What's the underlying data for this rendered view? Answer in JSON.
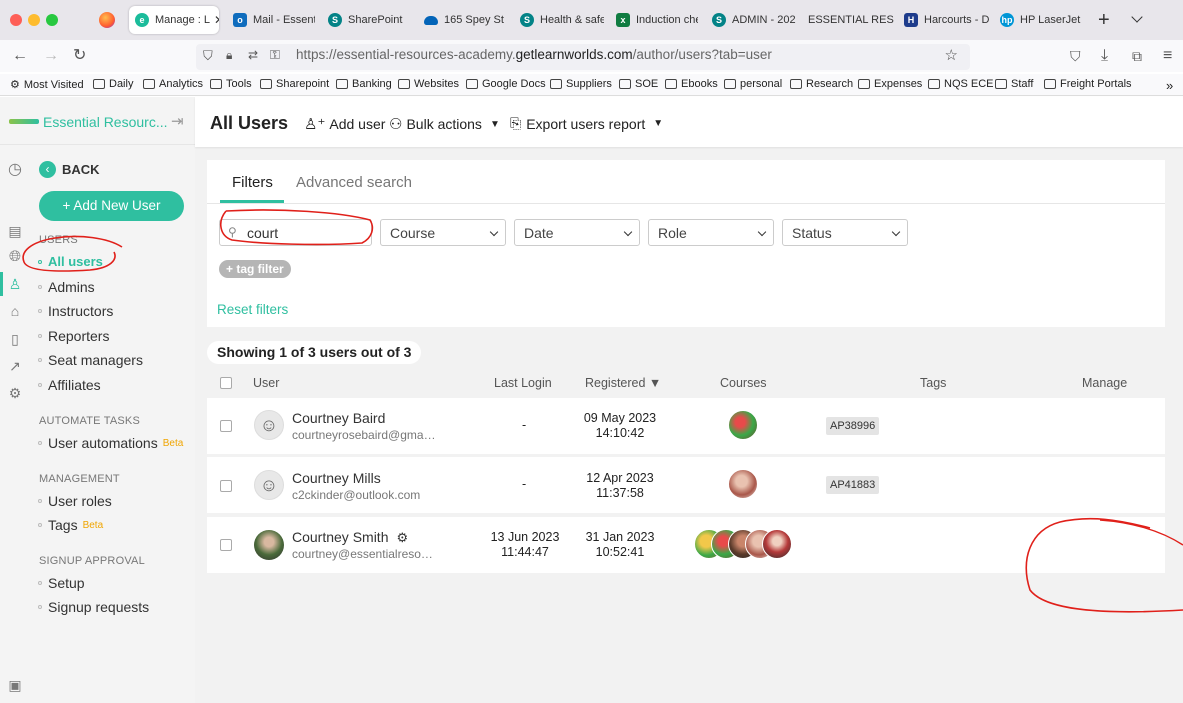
{
  "browser": {
    "tabs": [
      {
        "label": "Manage : L",
        "color": "#1bbc9b",
        "icon": "learnworlds-icon"
      },
      {
        "label": "Mail - Essenti",
        "color": "#0f6cbd",
        "icon": "outlook-icon"
      },
      {
        "label": "SharePoint",
        "color": "#038387",
        "icon": "sharepoint-icon"
      },
      {
        "label": "165 Spey St",
        "color": "#0364b8",
        "icon": "onedrive-icon"
      },
      {
        "label": "Health & safe",
        "color": "#038387",
        "icon": "sharepoint-icon"
      },
      {
        "label": "Induction che",
        "color": "#107c41",
        "icon": "excel-icon"
      },
      {
        "label": "ADMIN - 202",
        "color": "#038387",
        "icon": "sharepoint-icon"
      },
      {
        "label": "ESSENTIAL RESO",
        "color": "",
        "icon": "none"
      },
      {
        "label": "Harcourts - D",
        "color": "#1e3c8c",
        "icon": "harcourts-icon"
      },
      {
        "label": "HP LaserJet",
        "color": "#0096d6",
        "icon": "hp-icon"
      }
    ],
    "url_prefix": "https://essential-resources-academy.",
    "url_domain": "getlearnworlds.com",
    "url_suffix": "/author/users?tab=user",
    "bookmarks": [
      "Most Visited",
      "Daily",
      "Analytics",
      "Tools",
      "Sharepoint",
      "Banking",
      "Websites",
      "Google Docs",
      "Suppliers",
      "SOE",
      "Ebooks",
      "personal",
      "Research",
      "Expenses",
      "NQS ECE",
      "Staff",
      "Freight Portals"
    ]
  },
  "brand": {
    "name": "Essential Resourc..."
  },
  "sidebar": {
    "back": "BACK",
    "add_user": "+ Add New User",
    "users_heading": "USERS",
    "users_items": [
      "All users",
      "Admins",
      "Instructors",
      "Reporters",
      "Seat managers",
      "Affiliates"
    ],
    "automate_heading": "AUTOMATE TASKS",
    "automate_item": "User automations",
    "beta": "Beta",
    "management_heading": "MANAGEMENT",
    "management_items": [
      "User roles",
      "Tags"
    ],
    "signup_heading": "SIGNUP APPROVAL",
    "signup_items": [
      "Setup",
      "Signup requests"
    ]
  },
  "header": {
    "title": "All Users",
    "add_user": "Add user",
    "bulk_actions": "Bulk actions",
    "export": "Export users report"
  },
  "filters": {
    "tab_filters": "Filters",
    "tab_advanced": "Advanced search",
    "search_value": "court",
    "course": "Course",
    "date": "Date",
    "role": "Role",
    "status": "Status",
    "tag_filter": "+ tag filter",
    "reset": "Reset filters"
  },
  "table": {
    "showing": "Showing 1 of 3 users out of 3",
    "columns": [
      "User",
      "Last Login",
      "Registered ▼",
      "Courses",
      "Tags",
      "Manage"
    ],
    "rows": [
      {
        "name": "Courtney Baird",
        "email": "courtneyrosebaird@gmail.com",
        "last_login": "-",
        "reg_date": "09 May 2023",
        "reg_time": "14:10:42",
        "tag": "AP38996"
      },
      {
        "name": "Courtney Mills",
        "email": "c2ckinder@outlook.com",
        "last_login": "-",
        "reg_date": "12 Apr 2023",
        "reg_time": "11:37:58",
        "tag": "AP41883"
      },
      {
        "name": "Courtney Smith",
        "email": "courtney@essentialresources",
        "last_login_date": "13 Jun 2023",
        "last_login_time": "11:44:47",
        "reg_date": "31 Jan 2023",
        "reg_time": "10:52:41",
        "tag": ""
      }
    ]
  },
  "colors": {
    "accent": "#2fbfa0",
    "annotation": "#e0201a"
  }
}
